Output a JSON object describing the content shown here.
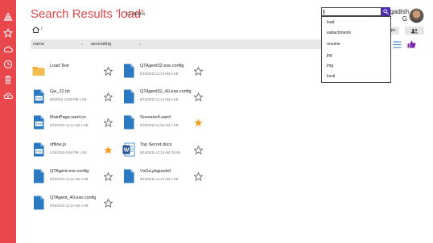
{
  "header": {
    "title": "Search Results 'load'",
    "count": "11 Items",
    "breadcrumb_sep": "/"
  },
  "sort": {
    "field": "name",
    "order": "ascending"
  },
  "user": {
    "name_line1": "Jagadish",
    "name_line2": "G"
  },
  "header_buttons": {
    "partial_label": "gm"
  },
  "search": {
    "value": "",
    "suggestions": [
      "load",
      "eattachments",
      "resume",
      "jpg",
      "img",
      "local"
    ]
  },
  "rail_icons": [
    "onedrive-logo-icon",
    "star-icon",
    "cloud-icon",
    "clock-icon",
    "trash-icon",
    "cloud-upload-icon"
  ],
  "files": [
    {
      "name": "Load Test",
      "meta": "",
      "icon": "folder-icon",
      "starred": false
    },
    {
      "name": "QTAgent32.exe.config",
      "meta": "8/16/2015 11:24 AM   4 KB",
      "icon": "file-icon",
      "starred": false
    },
    {
      "name": "Gw_22.txt",
      "meta": "5/6/2016 10:50 PM   1 KB",
      "icon": "txt-file-icon",
      "starred": false
    },
    {
      "name": "QTAgent32_40.exe.config",
      "meta": "8/16/2015 11:24 AM   4 KB",
      "icon": "file-icon",
      "starred": false
    },
    {
      "name": "MainPage.xaml.cs",
      "meta": "8/16/2015 11:24 AM   1 KB",
      "icon": "txt-file-icon",
      "starred": false
    },
    {
      "name": "Scenario4.xaml",
      "meta": "5/28/2015 11:58 AM   2 KB",
      "icon": "file-icon",
      "starred": true
    },
    {
      "name": "offline.js",
      "meta": "1/16/2015 8:50 PM   1 KB",
      "icon": "txt-file-icon",
      "starred": true
    },
    {
      "name": "Top Secret.docx",
      "meta": "8/16/2015 11:24 AM   20 KB",
      "icon": "word-icon",
      "starred": false
    },
    {
      "name": "QTAgent.exe.config",
      "meta": "8/16/2015 11:24 AM   4 KB",
      "icon": "file-icon",
      "starred": false
    },
    {
      "name": "VsGa.pkgundef",
      "meta": "8/16/2015 11:24 AM   1 KB",
      "icon": "file-icon",
      "starred": false
    },
    {
      "name": "QTAgent_40.exe.config",
      "meta": "8/16/2015 11:24 AM   4 KB",
      "icon": "file-icon",
      "starred": false
    }
  ],
  "colors": {
    "accent": "#e8474c",
    "title": "#e04848",
    "search_button": "#4d2bb0",
    "star_filled": "#f0a020",
    "file_blue": "#2b79c2",
    "folder": "#f3a932",
    "like": "#7a2bb0"
  }
}
